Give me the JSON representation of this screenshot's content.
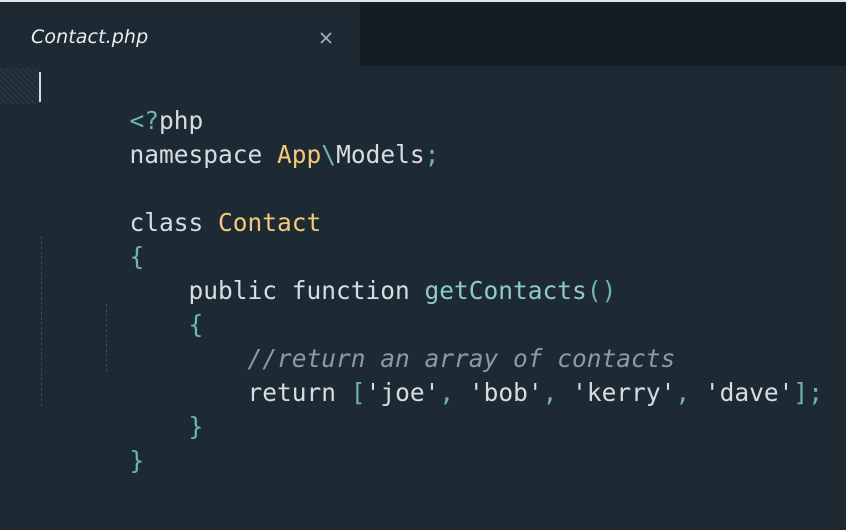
{
  "tab": {
    "title": "Contact.php",
    "close_glyph": "✕"
  },
  "code": {
    "line1": {
      "punct": "<?",
      "kw": "php"
    },
    "line2": {
      "kw": "namespace ",
      "ns1": "App",
      "sep": "\\",
      "ns2": "Models",
      "semi": ";"
    },
    "line4": {
      "kw": "class ",
      "name": "Contact"
    },
    "line5": {
      "brace": "{"
    },
    "line6": {
      "indent": "    ",
      "kw": "public function ",
      "fn": "getContacts",
      "parens": "()"
    },
    "line7": {
      "indent": "    ",
      "brace": "{"
    },
    "line8": {
      "indent": "        ",
      "comment": "//return an array of contacts"
    },
    "line9": {
      "indent": "        ",
      "kw": "return ",
      "open": "[",
      "items": [
        "'joe'",
        "'bob'",
        "'kerry'",
        "'dave'"
      ],
      "comma": ", ",
      "close": "]",
      "semi": ";"
    },
    "line10": {
      "indent": "    ",
      "brace": "}"
    },
    "line11": {
      "brace": "}"
    }
  },
  "colors": {
    "background": "#1d2a33",
    "tabbar": "#141d24",
    "keyword": "#d6dde2",
    "class_name": "#f2c97a",
    "function_name": "#8fc9c9",
    "punctuation": "#6fb3b8",
    "comment": "#8a9aa6"
  }
}
